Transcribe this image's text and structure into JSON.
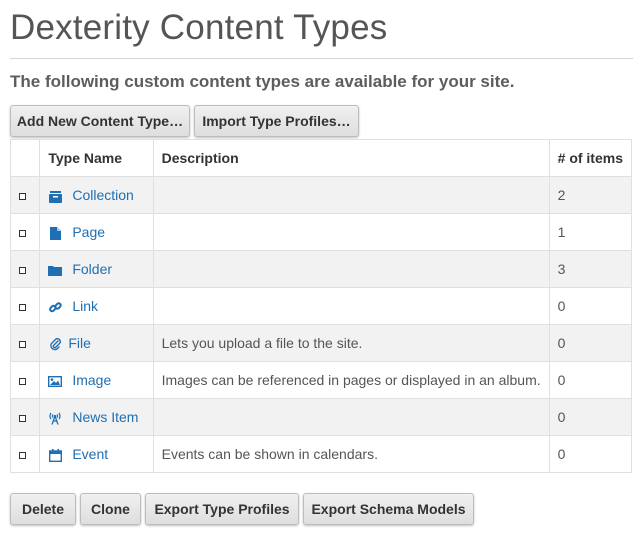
{
  "page_title": "Dexterity Content Types",
  "lead": "The following custom content types are available for your site.",
  "top_buttons": {
    "add": "Add New Content Type…",
    "import": "Import Type Profiles…"
  },
  "table": {
    "headers": {
      "type_name": "Type Name",
      "description": "Description",
      "items": "# of items"
    },
    "rows": [
      {
        "name": "Collection",
        "icon": "collection-icon",
        "description": "",
        "count": "2"
      },
      {
        "name": "Page",
        "icon": "page-icon",
        "description": "",
        "count": "1"
      },
      {
        "name": "Folder",
        "icon": "folder-icon",
        "description": "",
        "count": "3"
      },
      {
        "name": "Link",
        "icon": "link-icon",
        "description": "",
        "count": "0"
      },
      {
        "name": "File",
        "icon": "paperclip-icon",
        "description": "Lets you upload a file to the site.",
        "count": "0"
      },
      {
        "name": "Image",
        "icon": "image-icon",
        "description": "Images can be referenced in pages or displayed in an album.",
        "count": "0"
      },
      {
        "name": "News Item",
        "icon": "news-icon",
        "description": "",
        "count": "0"
      },
      {
        "name": "Event",
        "icon": "calendar-icon",
        "description": "Events can be shown in calendars.",
        "count": "0"
      }
    ]
  },
  "bottom_buttons": {
    "delete": "Delete",
    "clone": "Clone",
    "export_profiles": "Export Type Profiles",
    "export_models": "Export Schema Models"
  },
  "colors": {
    "link": "#1f6fb2",
    "row_stripe": "#f2f2f2",
    "button_bg": "#e6e6e6"
  }
}
